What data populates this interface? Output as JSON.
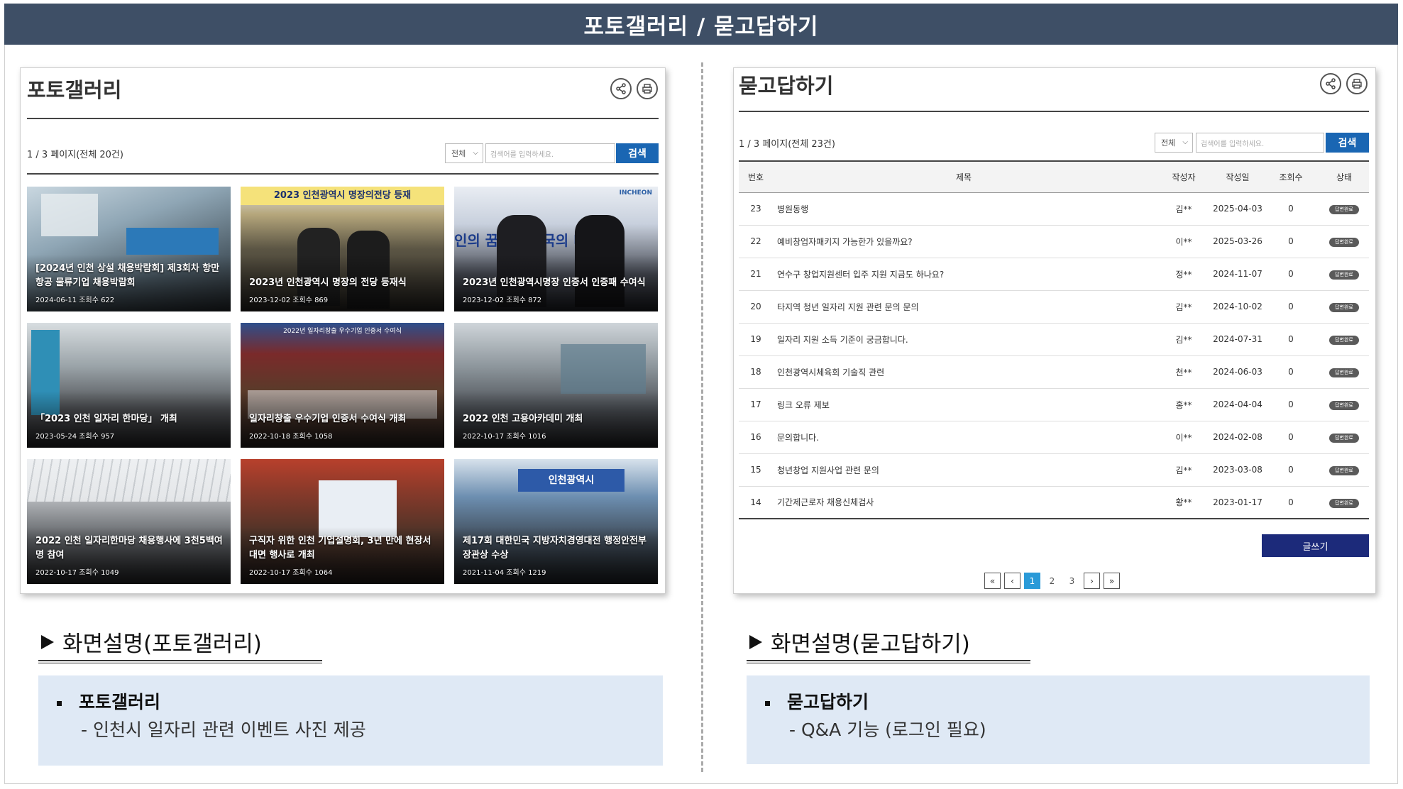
{
  "header": {
    "title": "포토갤러리 / 묻고답하기"
  },
  "gallery_panel": {
    "title": "포토갤러리",
    "page_info": "1 / 3 페이지(전체 20건)",
    "select_value": "전체",
    "search_placeholder": "검색어를 입력하세요.",
    "search_label": "검색",
    "photos": [
      {
        "title": "[2024년 인천 상설 채용박람회] 제3회차 항만 항공 물류기업 채용박람회",
        "meta": "2024-06-11 조회수 622"
      },
      {
        "title": "2023년 인천광역시 명장의 전당 등재식",
        "meta": "2023-12-02 조회수 869",
        "banner": "2023 인천광역시 명장의전당 등재"
      },
      {
        "title": "2023년 인천광역시명장 인증서 인증패 수여식",
        "meta": "2023-12-02 조회수 872",
        "logo": "INCHEON",
        "sign": "인의 꿈 대한민국의 미래"
      },
      {
        "title": "「2023 인천 일자리 한마당」 개최",
        "meta": "2023-05-24 조회수 957"
      },
      {
        "title": "일자리창출 우수기업 인증서 수여식 개최",
        "meta": "2022-10-18 조회수 1058",
        "banner": "2022년 일자리창출 우수기업 인증서 수여식"
      },
      {
        "title": "2022 인천 고용아카데미 개최",
        "meta": "2022-10-17 조회수 1016"
      },
      {
        "title": "2022 인천 일자리한마당 채용행사에 3천5백여 명 참여",
        "meta": "2022-10-17 조회수 1049"
      },
      {
        "title": "구직자 위한 인천 기업설명회, 3년 만에 현장서 대면 행사로 개최",
        "meta": "2022-10-17 조회수 1064"
      },
      {
        "title": "제17회 대한민국 지방자치경영대전 행정안전부 장관상 수상",
        "meta": "2021-11-04 조회수 1219",
        "sign": "인천광역시"
      }
    ]
  },
  "qna_panel": {
    "title": "묻고답하기",
    "page_info": "1 / 3 페이지(전체 23건)",
    "select_value": "전체",
    "search_placeholder": "검색어를 입력하세요.",
    "search_label": "검색",
    "columns": [
      "번호",
      "제목",
      "작성자",
      "작성일",
      "조회수",
      "상태"
    ],
    "rows": [
      {
        "no": "23",
        "title": "병원동행",
        "author": "김**",
        "date": "2025-04-03",
        "views": "0",
        "status": "답변완료"
      },
      {
        "no": "22",
        "title": "예비창업자패키지 가능한가 있을까요?",
        "author": "이**",
        "date": "2025-03-26",
        "views": "0",
        "status": "답변완료"
      },
      {
        "no": "21",
        "title": "연수구 창업지원센터 입주 지원 지금도 하나요?",
        "author": "정**",
        "date": "2024-11-07",
        "views": "0",
        "status": "답변완료"
      },
      {
        "no": "20",
        "title": "타지역 청년 일자리 지원 관련 문의 문의",
        "author": "김**",
        "date": "2024-10-02",
        "views": "0",
        "status": "답변완료"
      },
      {
        "no": "19",
        "title": "일자리 지원 소득 기준이 궁금합니다.",
        "author": "김**",
        "date": "2024-07-31",
        "views": "0",
        "status": "답변완료"
      },
      {
        "no": "18",
        "title": "인천광역시체육회 기술직 관련",
        "author": "천**",
        "date": "2024-06-03",
        "views": "0",
        "status": "답변완료"
      },
      {
        "no": "17",
        "title": "링크 오류 제보",
        "author": "홍**",
        "date": "2024-04-04",
        "views": "0",
        "status": "답변완료"
      },
      {
        "no": "16",
        "title": "문의합니다.",
        "author": "이**",
        "date": "2024-02-08",
        "views": "0",
        "status": "답변완료"
      },
      {
        "no": "15",
        "title": "청년창업 지원사업 관련 문의",
        "author": "김**",
        "date": "2023-03-08",
        "views": "0",
        "status": "답변완료"
      },
      {
        "no": "14",
        "title": "기간제근로자 채용신체검사",
        "author": "황**",
        "date": "2023-01-17",
        "views": "0",
        "status": "답변완료"
      }
    ],
    "write_label": "글쓰기",
    "pager": {
      "first": "«",
      "prev": "‹",
      "pages": [
        "1",
        "2",
        "3"
      ],
      "next": "›",
      "last": "»"
    }
  },
  "desc_gallery": {
    "heading": "화면설명(포토갤러리)",
    "item": "포토갤러리",
    "sub": "- 인천시 일자리 관련 이벤트 사진 제공"
  },
  "desc_qna": {
    "heading": "화면설명(묻고답하기)",
    "item": "묻고답하기",
    "sub": "- Q&A 기능 (로그인 필요)"
  },
  "icons": {
    "share": "share-icon",
    "print": "print-icon",
    "triangle": "play-triangle-icon"
  },
  "colors": {
    "topbar": "#3e4f66",
    "search": "#1a66b3",
    "write": "#1c2a7a",
    "active_page": "#2a9ad8",
    "desc_box": "#dfe9f5"
  }
}
